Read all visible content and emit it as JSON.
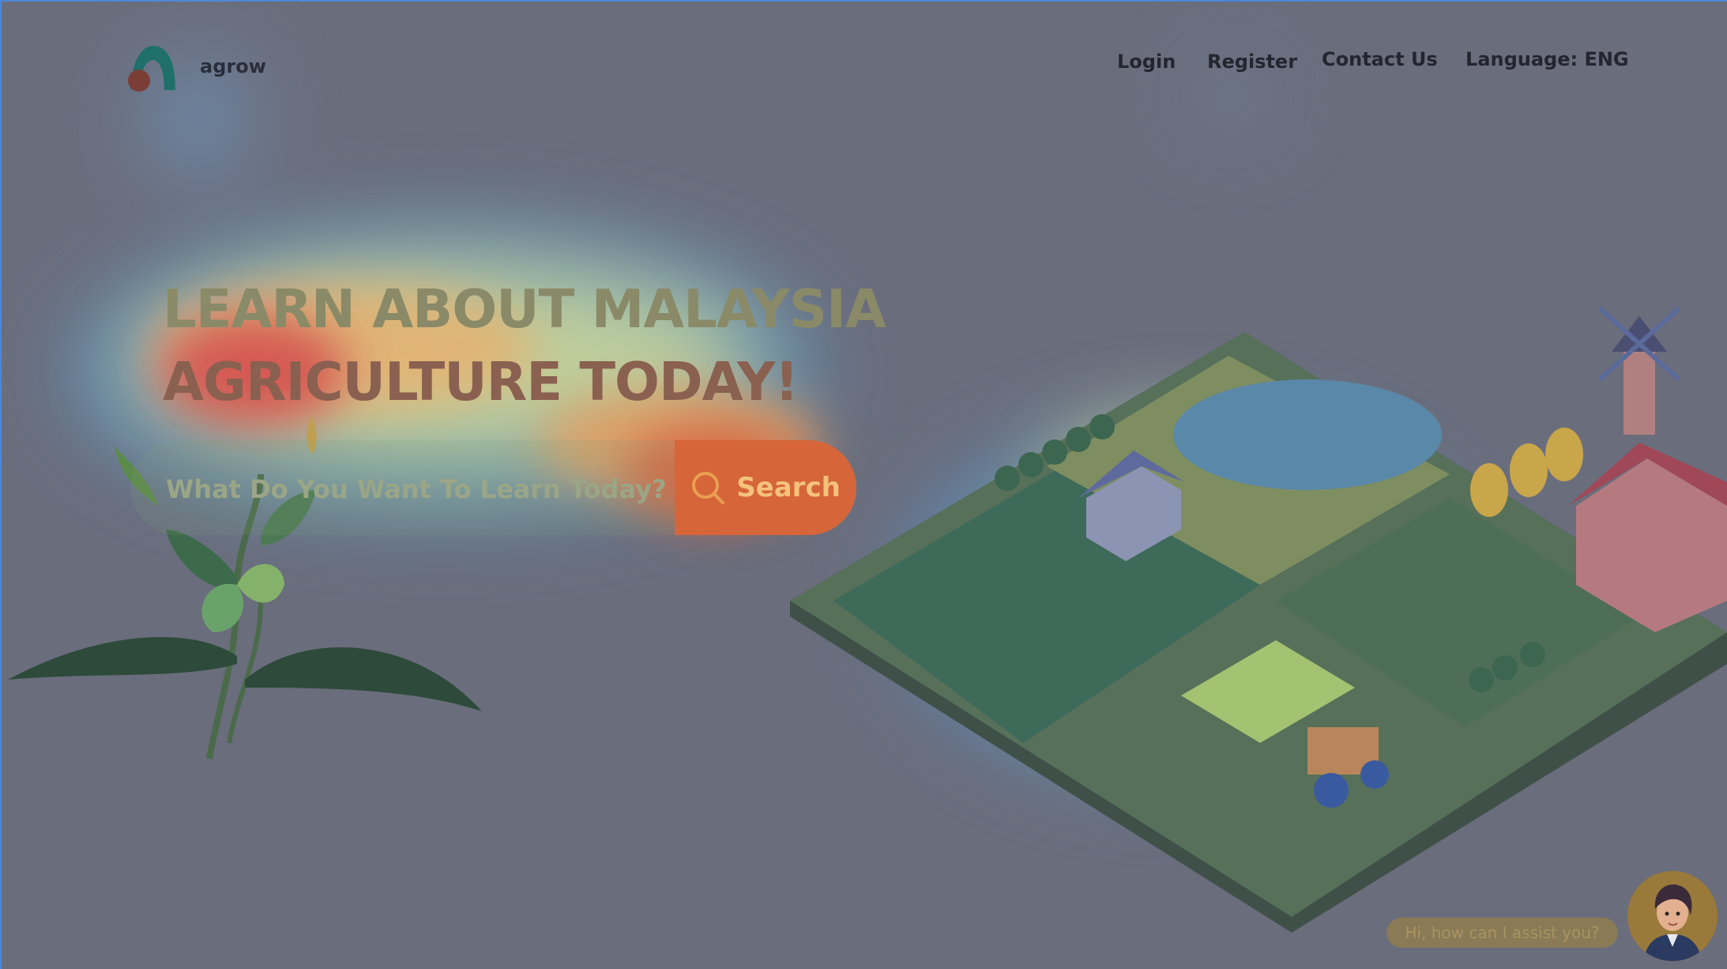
{
  "header": {
    "brand": "agrow",
    "nav": {
      "login": "Login",
      "register": "Register",
      "contact": "Contact Us",
      "language": "Language: ENG"
    }
  },
  "hero": {
    "title_line1": "LEARN ABOUT MALAYSIA",
    "title_line2": "AGRICULTURE TODAY!",
    "search_placeholder": "What Do You Want To Learn Today?",
    "search_button": "Search"
  },
  "chat": {
    "prompt": "Hi, how can I assist you?"
  },
  "colors": {
    "background": "#6a6d7c",
    "search_button": "#d6653a",
    "logo_teal": "#1f6f6a",
    "logo_red": "#7b3e36"
  },
  "icons": [
    "search-icon"
  ]
}
